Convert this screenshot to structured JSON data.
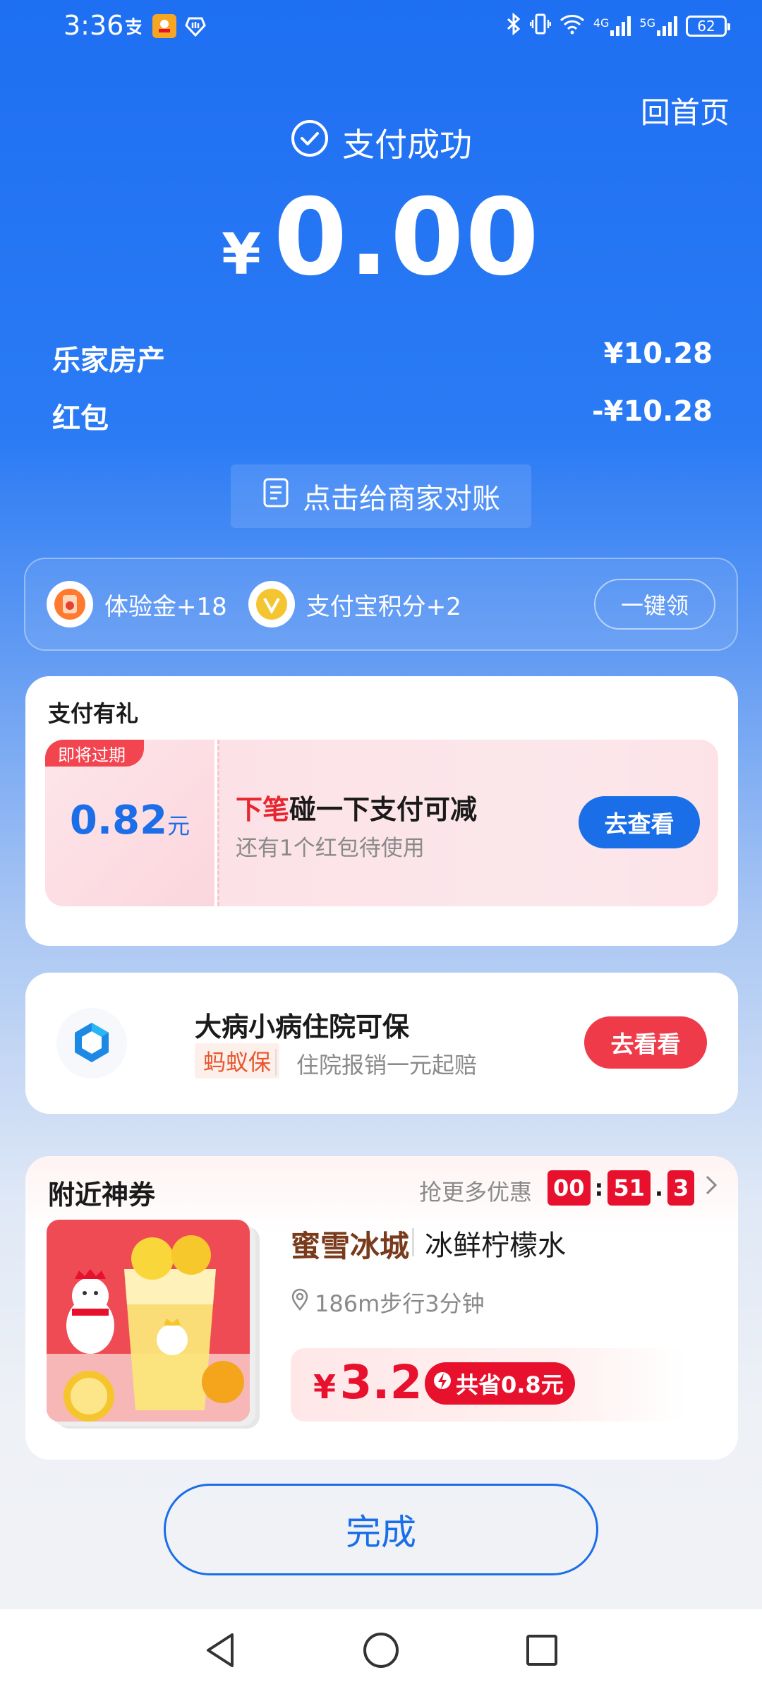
{
  "status_bar": {
    "time": "3:36",
    "battery": "62",
    "left_icons": [
      "alipay-icon",
      "app-badge-icon",
      "hand-icon"
    ],
    "right_icons": [
      "bluetooth-icon",
      "vibrate-icon",
      "wifi-icon",
      "signal-4g-icon",
      "signal-5g-icon",
      "battery-icon"
    ],
    "net1": "4G",
    "net2": "5G"
  },
  "header": {
    "home_link": "回首页",
    "success_text": "支付成功",
    "currency": "¥",
    "amount": "0.00"
  },
  "details": [
    {
      "label": "乐家房产",
      "value": "¥10.28"
    },
    {
      "label": "红包",
      "value": "-¥10.28"
    }
  ],
  "reconcile_button": "点击给商家对账",
  "points": {
    "item1": "体验金+18",
    "item2": "支付宝积分+2",
    "claim": "一键领"
  },
  "pay_gift": {
    "title": "支付有礼",
    "expire_tag": "即将过期",
    "amount": "0.82",
    "unit": "元",
    "head_red": "下笔",
    "head_rest": "碰一下支付可减",
    "sub": "还有1个红包待使用",
    "button": "去查看"
  },
  "insurance": {
    "title": "大病小病住院可保",
    "tag": "蚂蚁保",
    "sub": "住院报销一元起赔",
    "button": "去看看"
  },
  "nearby": {
    "title": "附近神券",
    "more": "抢更多优惠",
    "timer": [
      "00",
      "51",
      "3"
    ],
    "timer_sep1": ":",
    "timer_sep2": ".",
    "store": "蜜雪冰城",
    "product": "冰鲜柠檬水",
    "distance": "186m步行3分钟",
    "price_currency": "¥",
    "price": "3.2",
    "save": "共省0.8元"
  },
  "done_button": "完成",
  "colors": {
    "primary": "#1a6ee8",
    "red": "#e8112d",
    "header_bg": "#1e6ff2"
  }
}
